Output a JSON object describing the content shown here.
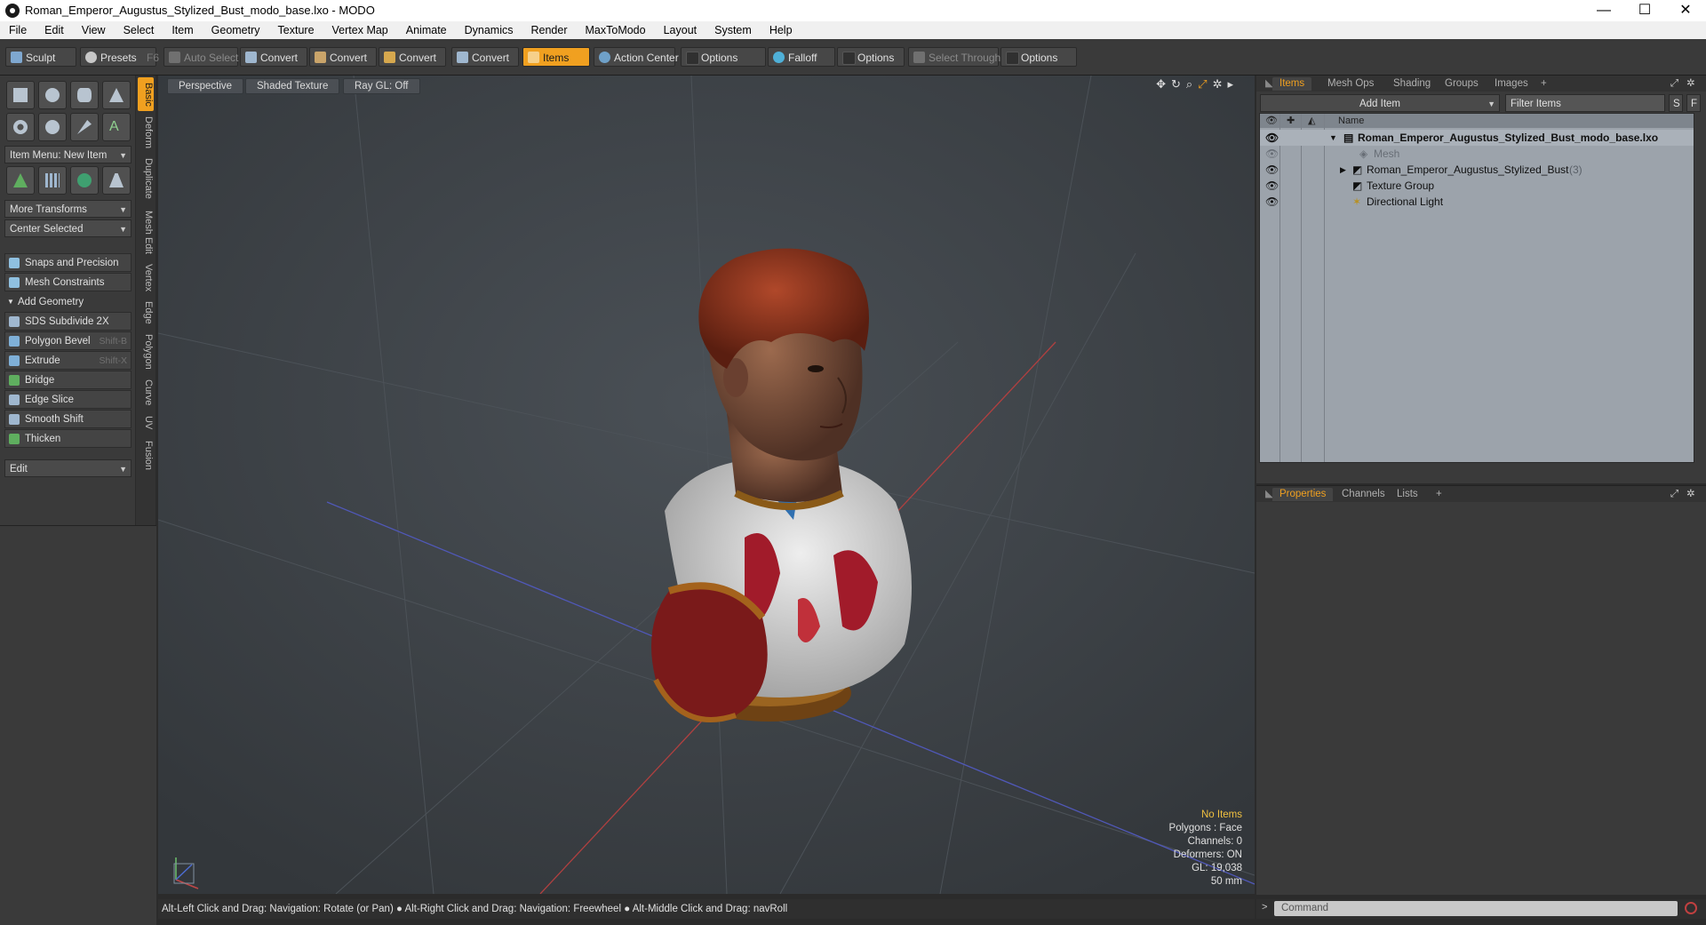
{
  "window": {
    "title": "Roman_Emperor_Augustus_Stylized_Bust_modo_base.lxo - MODO",
    "minimize": "—",
    "maximize": "☐",
    "close": "✕"
  },
  "menu": [
    "File",
    "Edit",
    "View",
    "Select",
    "Item",
    "Geometry",
    "Texture",
    "Vertex Map",
    "Animate",
    "Dynamics",
    "Render",
    "MaxToModo",
    "Layout",
    "System",
    "Help"
  ],
  "toolbar": {
    "sculpt": "Sculpt",
    "presets": "Presets",
    "presets_key": "F6",
    "auto_select": "Auto Select",
    "convert1": "Convert",
    "convert2": "Convert",
    "convert3": "Convert",
    "convert4": "Convert",
    "items": "Items",
    "action_center": "Action Center",
    "options1": "Options",
    "falloff": "Falloff",
    "options2": "Options",
    "select_through": "Select Through",
    "options3": "Options"
  },
  "left": {
    "item_menu": "Item Menu: New Item",
    "more_transforms": "More Transforms",
    "center_selected": "Center Selected",
    "snaps": "Snaps and Precision",
    "mesh_constraints": "Mesh Constraints",
    "add_geometry": "Add Geometry",
    "tools": [
      {
        "label": "SDS Subdivide 2X",
        "shortcut": ""
      },
      {
        "label": "Polygon Bevel",
        "shortcut": "Shift-B"
      },
      {
        "label": "Extrude",
        "shortcut": "Shift-X"
      },
      {
        "label": "Bridge",
        "shortcut": ""
      },
      {
        "label": "Edge Slice",
        "shortcut": ""
      },
      {
        "label": "Smooth Shift",
        "shortcut": ""
      },
      {
        "label": "Thicken",
        "shortcut": ""
      }
    ],
    "edit": "Edit",
    "vtabs": [
      "Basic",
      "Deform",
      "Duplicate",
      "Mesh Edit",
      "Vertex",
      "Edge",
      "Polygon",
      "Curve",
      "UV",
      "Fusion"
    ]
  },
  "viewport": {
    "view": "Perspective",
    "shading": "Shaded Texture",
    "raygl": "Ray GL: Off",
    "stats": {
      "items": "No Items",
      "polygons": "Polygons : Face",
      "channels": "Channels: 0",
      "deformers": "Deformers: ON",
      "gl": "GL: 19,038",
      "focal": "50 mm"
    }
  },
  "status": "Alt-Left Click and Drag: Navigation: Rotate (or Pan) ● Alt-Right Click and Drag: Navigation: Freewheel ● Alt-Middle Click and Drag: navRoll",
  "items_panel": {
    "tabs": [
      "Items",
      "Mesh Ops",
      "Shading",
      "Groups",
      "Images"
    ],
    "add_item": "Add Item",
    "filter": "Filter Items",
    "s_btn": "S",
    "f_btn": "F",
    "name_col": "Name",
    "rows": [
      {
        "label": "Roman_Emperor_Augustus_Stylized_Bust_modo_base.lxo",
        "extra": ""
      },
      {
        "label": "Mesh",
        "extra": ""
      },
      {
        "label": "Roman_Emperor_Augustus_Stylized_Bust",
        "extra": "(3)"
      },
      {
        "label": "Texture Group",
        "extra": ""
      },
      {
        "label": "Directional Light",
        "extra": ""
      }
    ]
  },
  "props_panel": {
    "tabs": [
      "Properties",
      "Channels",
      "Lists"
    ]
  },
  "command": {
    "placeholder": "Command"
  },
  "colors": {
    "accent": "#f0a020",
    "viewport_bg": "#3b4045",
    "panel": "#3a3a3a"
  }
}
